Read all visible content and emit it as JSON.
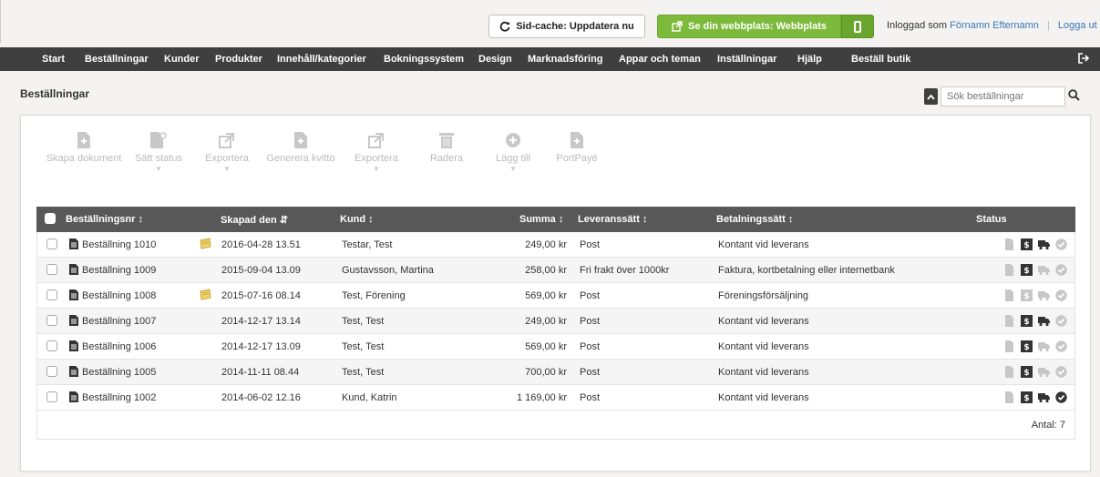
{
  "topbar": {
    "cache_button": "Sid-cache: Uppdatera nu",
    "site_button": "Se din webbplats: Webbplats",
    "logged_in_label": "Inloggad som",
    "user_name": "Förnamn Efternamn",
    "logout": "Logga ut"
  },
  "nav": {
    "items": [
      "Start",
      "Beställningar",
      "Kunder",
      "Produkter",
      "Innehåll/kategorier",
      "Bokningssystem",
      "Design",
      "Marknadsföring",
      "Appar och teman",
      "Inställningar",
      "Hjälp",
      "Beställ butik"
    ]
  },
  "header": {
    "title": "Beställningar",
    "search_placeholder": "Sök beställningar"
  },
  "toolbar": {
    "create_document": "Skapa dokument",
    "set_status": "Sätt status",
    "export": "Exportera",
    "generate_receipt": "Generera kvitto",
    "export2": "Exportera",
    "delete": "Radera",
    "add": "Lägg till",
    "portpaye": "PortPayé"
  },
  "table": {
    "columns": {
      "order_no": "Beställningsnr",
      "created": "Skapad den",
      "customer": "Kund",
      "sum": "Summa",
      "delivery": "Leveranssätt",
      "payment": "Betalningssätt",
      "status": "Status"
    },
    "rows": [
      {
        "order": "Beställning 1010",
        "note": true,
        "created": "2016-04-28 13.51",
        "customer": "Testar, Test",
        "sum": "249,00 kr",
        "delivery": "Post",
        "payment": "Kontant vid leverans",
        "status": [
          false,
          true,
          true,
          false
        ]
      },
      {
        "order": "Beställning 1009",
        "note": false,
        "created": "2015-09-04 13.09",
        "customer": "Gustavsson, Martina",
        "sum": "258,00 kr",
        "delivery": "Fri frakt över 1000kr",
        "payment": "Faktura, kortbetalning eller internetbank",
        "status": [
          false,
          true,
          false,
          false
        ]
      },
      {
        "order": "Beställning 1008",
        "note": true,
        "created": "2015-07-16 08.14",
        "customer": "Test, Förening",
        "sum": "569,00 kr",
        "delivery": "Post",
        "payment": "Föreningsförsäljning",
        "status": [
          false,
          false,
          false,
          false
        ]
      },
      {
        "order": "Beställning 1007",
        "note": false,
        "created": "2014-12-17 13.14",
        "customer": "Test, Test",
        "sum": "249,00 kr",
        "delivery": "Post",
        "payment": "Kontant vid leverans",
        "status": [
          false,
          true,
          true,
          false
        ]
      },
      {
        "order": "Beställning 1006",
        "note": false,
        "created": "2014-12-17 13.09",
        "customer": "Test, Test",
        "sum": "569,00 kr",
        "delivery": "Post",
        "payment": "Kontant vid leverans",
        "status": [
          false,
          true,
          false,
          false
        ]
      },
      {
        "order": "Beställning 1005",
        "note": false,
        "created": "2014-11-11 08.44",
        "customer": "Test, Test",
        "sum": "700,00 kr",
        "delivery": "Post",
        "payment": "Kontant vid leverans",
        "status": [
          false,
          true,
          false,
          false
        ]
      },
      {
        "order": "Beställning 1002",
        "note": false,
        "created": "2014-06-02 12.16",
        "customer": "Kund, Katrin",
        "sum": "1 169,00 kr",
        "delivery": "Post",
        "payment": "Kontant vid leverans",
        "status": [
          false,
          true,
          true,
          true
        ]
      }
    ],
    "count_label": "Antal: 7"
  },
  "colors": {
    "nav_bg": "#3f3f3f",
    "accent_green": "#7dba3c",
    "link_blue": "#3a78b7",
    "table_header": "#585858"
  }
}
